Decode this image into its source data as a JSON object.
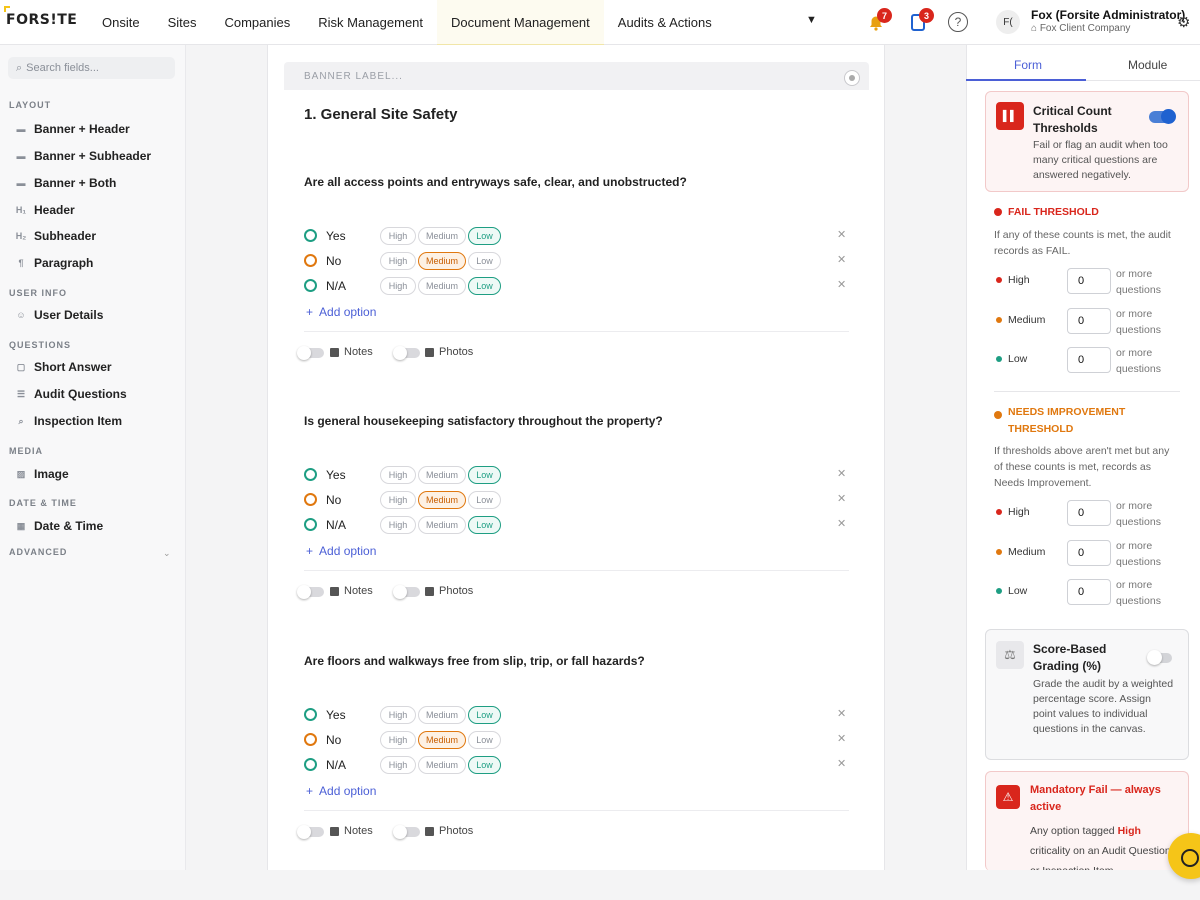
{
  "brand": {
    "logo": "FORS!TE"
  },
  "nav": {
    "items": [
      "Onsite",
      "Sites",
      "Companies",
      "Risk Management",
      "Document Management",
      "Audits & Actions"
    ],
    "notifications": "7",
    "tasks": "3",
    "help": "?",
    "avatar_initials": "F(",
    "user_name": "Fox (Forsite Administrator)",
    "user_company": "Fox Client Company"
  },
  "sidebar": {
    "search_placeholder": "Search fields...",
    "sections": [
      {
        "title": "LAYOUT",
        "items": [
          "Banner + Header",
          "Banner + Subheader",
          "Banner + Both",
          "Header",
          "Subheader",
          "Paragraph"
        ]
      },
      {
        "title": "USER INFO",
        "items": [
          "User Details"
        ]
      },
      {
        "title": "QUESTIONS",
        "items": [
          "Short Answer",
          "Audit Questions",
          "Inspection Item"
        ]
      },
      {
        "title": "MEDIA",
        "items": [
          "Image"
        ]
      },
      {
        "title": "DATE & TIME",
        "items": [
          "Date & Time"
        ]
      },
      {
        "title": "ADVANCED",
        "items": []
      }
    ]
  },
  "canvas": {
    "banner_label": "BANNER LABEL...",
    "section_title": "1. General Site Safety",
    "criticality": {
      "high": "High",
      "medium": "Medium",
      "low": "Low"
    },
    "add_option": "Add option",
    "notes_label": "Notes",
    "photos_label": "Photos",
    "questions": [
      {
        "text": "Are all access points and entryways safe, clear, and unobstructed?",
        "options": [
          {
            "label": "Yes",
            "sel": "low"
          },
          {
            "label": "No",
            "sel": "medium"
          },
          {
            "label": "N/A",
            "sel": "low"
          }
        ]
      },
      {
        "text": "Is general housekeeping satisfactory throughout the property?",
        "options": [
          {
            "label": "Yes",
            "sel": "low"
          },
          {
            "label": "No",
            "sel": "medium"
          },
          {
            "label": "N/A",
            "sel": "low"
          }
        ]
      },
      {
        "text": "Are floors and walkways free from slip, trip, or fall hazards?",
        "options": [
          {
            "label": "Yes",
            "sel": "low"
          },
          {
            "label": "No",
            "sel": "medium"
          },
          {
            "label": "N/A",
            "sel": "low"
          }
        ]
      }
    ]
  },
  "panel": {
    "tabs": [
      "Form",
      "Module"
    ],
    "critical": {
      "title": "Critical Count Thresholds",
      "desc": "Fail or flag an audit when too many critical questions are answered negatively.",
      "enabled": true
    },
    "fail": {
      "title": "FAIL THRESHOLD",
      "desc": "If any of these counts is met, the audit records as FAIL."
    },
    "needs": {
      "title": "NEEDS IMPROVEMENT THRESHOLD",
      "desc": "If thresholds above aren't met but any of these counts is met, records as Needs Improvement."
    },
    "levels": [
      "High",
      "Medium",
      "Low"
    ],
    "fail_values": [
      "0",
      "0",
      "0"
    ],
    "needs_values": [
      "0",
      "0",
      "0"
    ],
    "or_more": "or more questions",
    "score": {
      "title": "Score-Based Grading (%)",
      "desc": "Grade the audit by a weighted percentage score. Assign point values to individual questions in the canvas.",
      "enabled": false
    },
    "mandatory": {
      "title": "Mandatory Fail — always active",
      "desc_pre": "Any option tagged",
      "desc_high": "High",
      "desc_post": "criticality on an Audit Question or Inspection Item"
    }
  },
  "colors": {
    "accent": "#4b5fd6",
    "fail": "#d9261c",
    "needs": "#e0780f",
    "low": "#1e9e83",
    "brand": "#f5c518"
  }
}
